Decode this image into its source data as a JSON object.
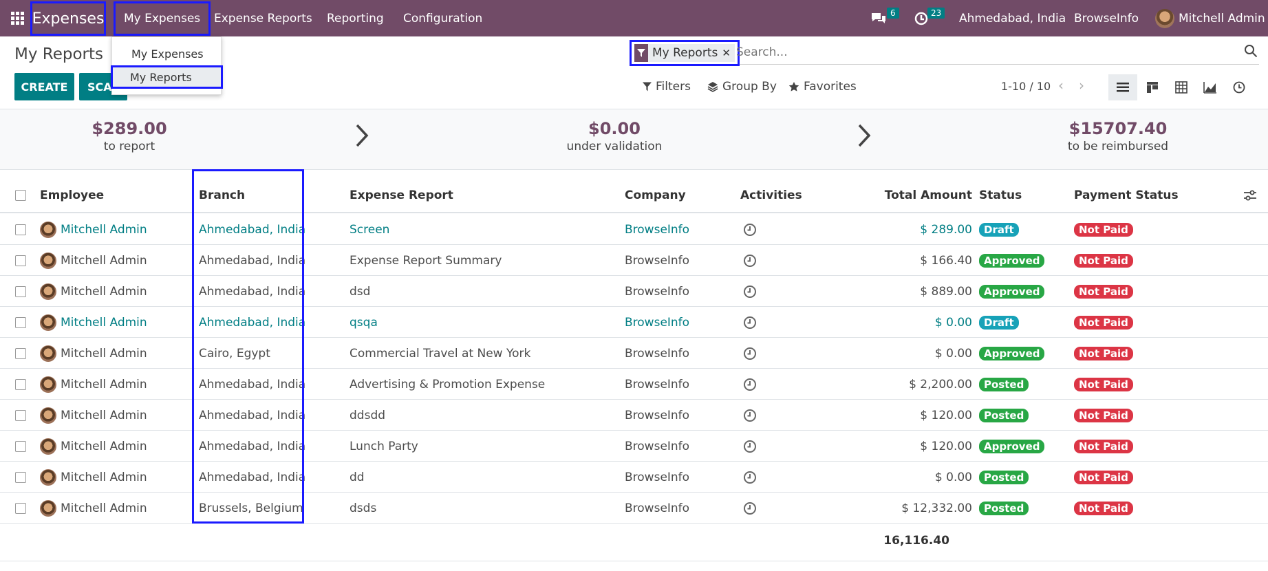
{
  "nav": {
    "app_name": "Expenses",
    "menu": [
      "My Expenses",
      "Expense Reports",
      "Reporting",
      "Configuration"
    ],
    "messages_count": "6",
    "activities_count": "23",
    "branch": "Ahmedabad, India",
    "company": "BrowseInfo",
    "user": "Mitchell Admin"
  },
  "dropdown": {
    "items": [
      "My Expenses",
      "My Reports"
    ]
  },
  "page": {
    "title": "My Reports"
  },
  "buttons": {
    "create": "CREATE",
    "scan": "SCA"
  },
  "search": {
    "facet": "My Reports",
    "placeholder": "Search..."
  },
  "controls": {
    "filters": "Filters",
    "group_by": "Group By",
    "favorites": "Favorites",
    "pager": "1-10 / 10"
  },
  "summary": [
    {
      "amount": "$289.00",
      "label": "to report"
    },
    {
      "amount": "$0.00",
      "label": "under validation"
    },
    {
      "amount": "$15707.40",
      "label": "to be reimbursed"
    }
  ],
  "table": {
    "headers": [
      "Employee",
      "Branch",
      "Expense Report",
      "Company",
      "Activities",
      "Total Amount",
      "Status",
      "Payment Status"
    ],
    "rows": [
      {
        "employee": "Mitchell Admin",
        "branch": "Ahmedabad, India",
        "report": "Screen",
        "company": "BrowseInfo",
        "amount": "$ 289.00",
        "status": "Draft",
        "payment": "Not Paid",
        "link": true
      },
      {
        "employee": "Mitchell Admin",
        "branch": "Ahmedabad, India",
        "report": "Expense Report Summary",
        "company": "BrowseInfo",
        "amount": "$ 166.40",
        "status": "Approved",
        "payment": "Not Paid",
        "link": false
      },
      {
        "employee": "Mitchell Admin",
        "branch": "Ahmedabad, India",
        "report": "dsd",
        "company": "BrowseInfo",
        "amount": "$ 889.00",
        "status": "Approved",
        "payment": "Not Paid",
        "link": false
      },
      {
        "employee": "Mitchell Admin",
        "branch": "Ahmedabad, India",
        "report": "qsqa",
        "company": "BrowseInfo",
        "amount": "$ 0.00",
        "status": "Draft",
        "payment": "Not Paid",
        "link": true
      },
      {
        "employee": "Mitchell Admin",
        "branch": "Cairo, Egypt",
        "report": "Commercial Travel at New York",
        "company": "BrowseInfo",
        "amount": "$ 0.00",
        "status": "Approved",
        "payment": "Not Paid",
        "link": false
      },
      {
        "employee": "Mitchell Admin",
        "branch": "Ahmedabad, India",
        "report": "Advertising & Promotion Expense",
        "company": "BrowseInfo",
        "amount": "$ 2,200.00",
        "status": "Posted",
        "payment": "Not Paid",
        "link": false
      },
      {
        "employee": "Mitchell Admin",
        "branch": "Ahmedabad, India",
        "report": "ddsdd",
        "company": "BrowseInfo",
        "amount": "$ 120.00",
        "status": "Posted",
        "payment": "Not Paid",
        "link": false
      },
      {
        "employee": "Mitchell Admin",
        "branch": "Ahmedabad, India",
        "report": "Lunch Party",
        "company": "BrowseInfo",
        "amount": "$ 120.00",
        "status": "Approved",
        "payment": "Not Paid",
        "link": false
      },
      {
        "employee": "Mitchell Admin",
        "branch": "Ahmedabad, India",
        "report": "dd",
        "company": "BrowseInfo",
        "amount": "$ 0.00",
        "status": "Posted",
        "payment": "Not Paid",
        "link": false
      },
      {
        "employee": "Mitchell Admin",
        "branch": "Brussels, Belgium",
        "report": "dsds",
        "company": "BrowseInfo",
        "amount": "$ 12,332.00",
        "status": "Posted",
        "payment": "Not Paid",
        "link": false
      }
    ],
    "total": "16,116.40"
  },
  "colors": {
    "topbar": "#714b67",
    "teal": "#017e84",
    "draft": "#17a2b8",
    "approved": "#28a745",
    "posted": "#28a745",
    "not_paid": "#dc3545",
    "highlight": "#1a1aff"
  }
}
